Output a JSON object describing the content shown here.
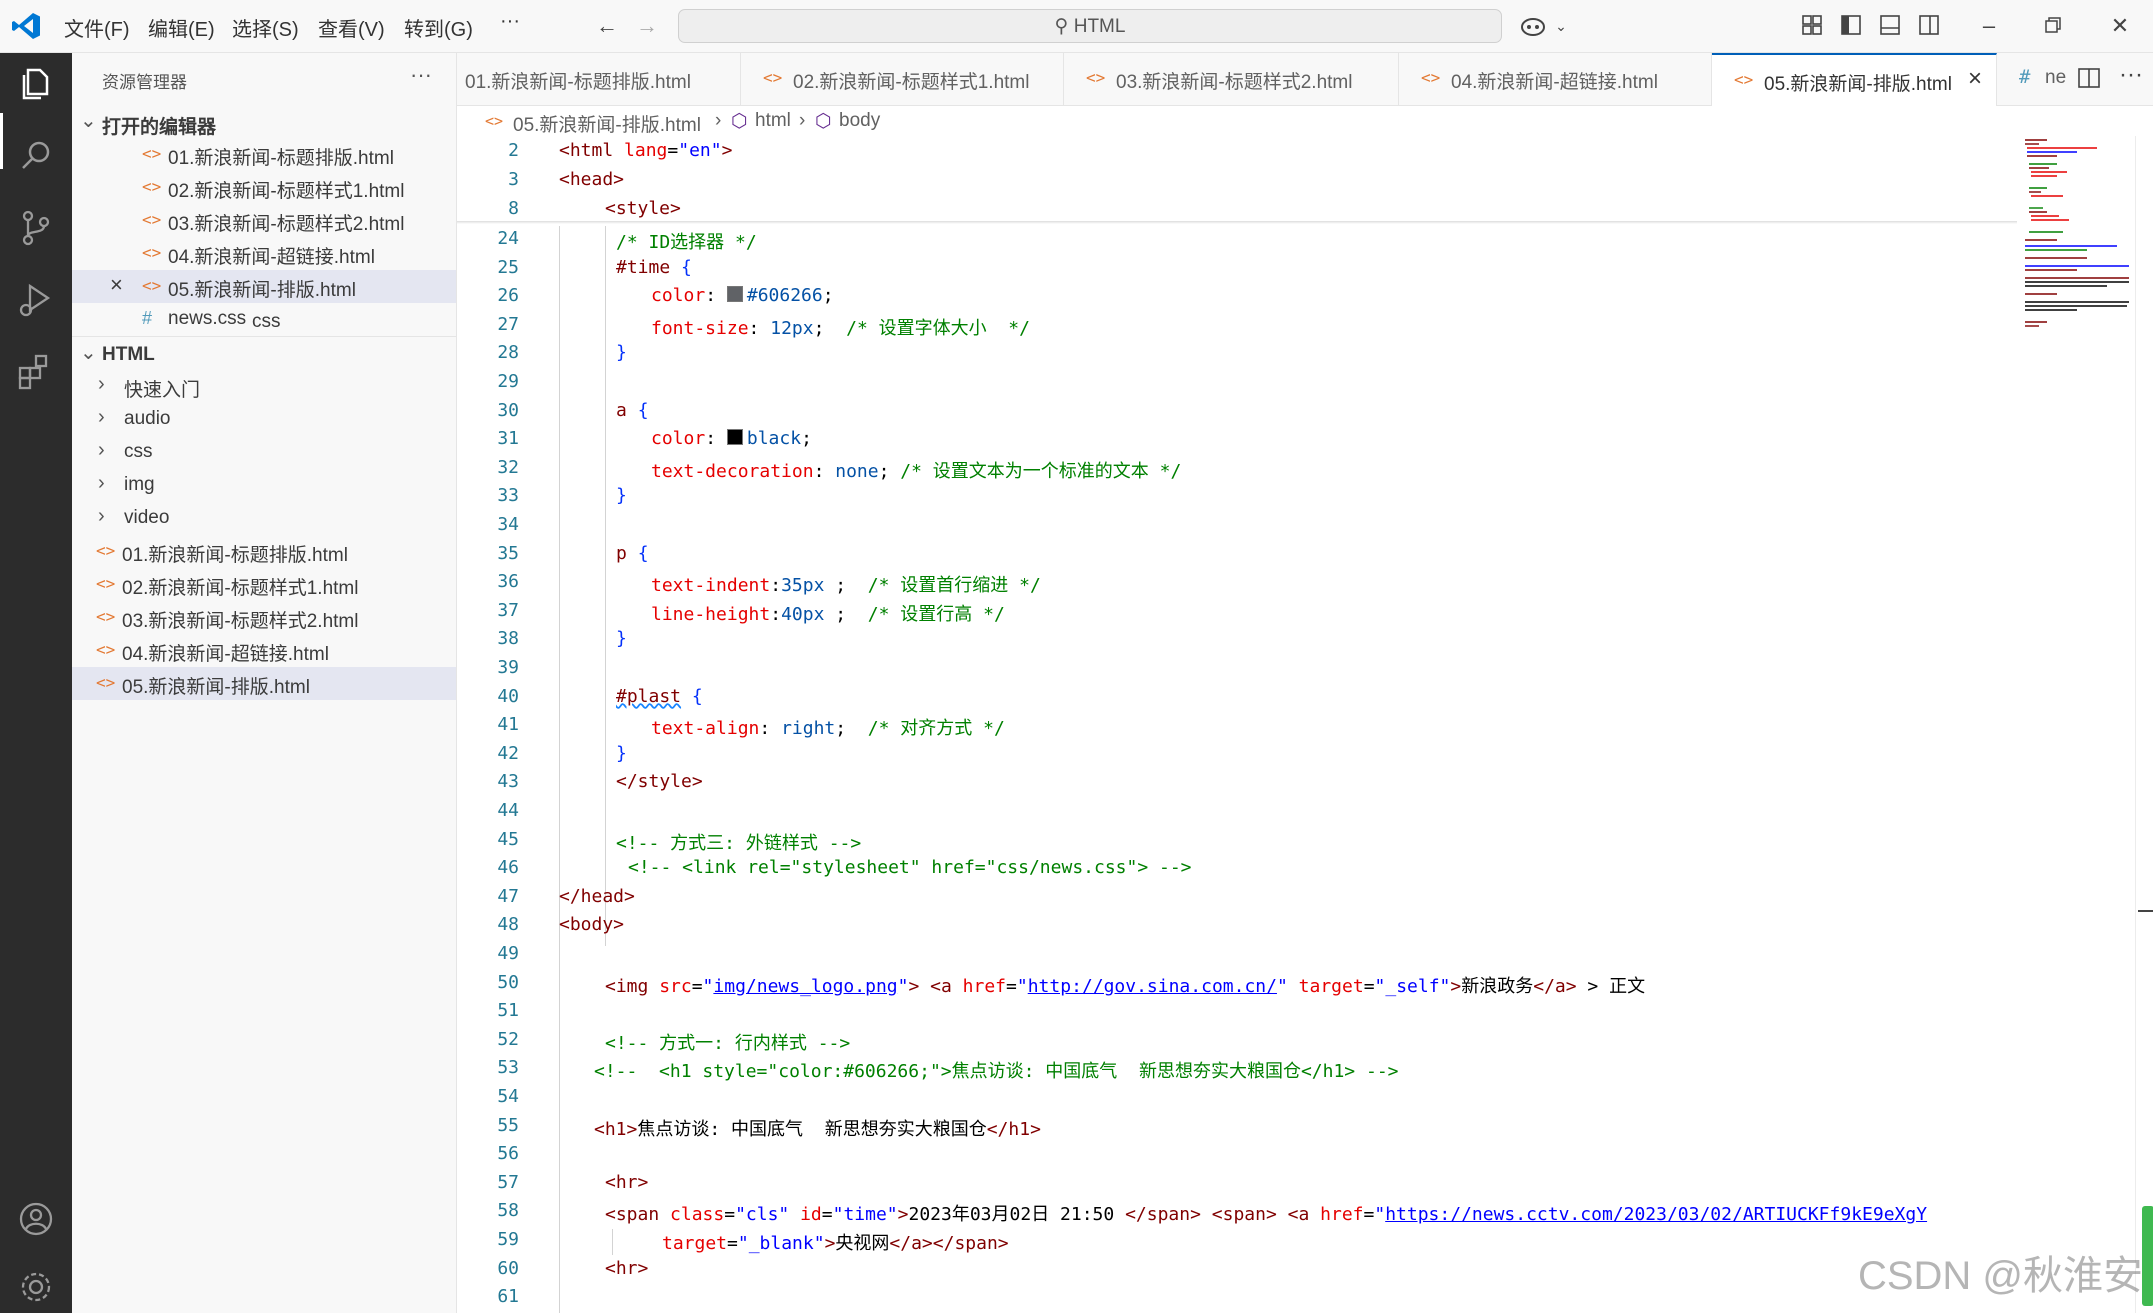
{
  "menu": {
    "file": "文件(F)",
    "edit": "编辑(E)",
    "select": "选择(S)",
    "view": "查看(V)",
    "goto": "转到(G)",
    "more": "···"
  },
  "command_center": {
    "label": "HTML"
  },
  "sidebar": {
    "title": "资源管理器",
    "more": "···",
    "open_editors_header": "打开的编辑器",
    "open_editors": [
      {
        "name": "01.新浪新闻-标题排版.html"
      },
      {
        "name": "02.新浪新闻-标题样式1.html"
      },
      {
        "name": "03.新浪新闻-标题样式2.html"
      },
      {
        "name": "04.新浪新闻-超链接.html"
      },
      {
        "name": "05.新浪新闻-排版.html"
      },
      {
        "name": "news.css",
        "hint": "css"
      }
    ],
    "folder_header": "HTML",
    "folders": [
      "快速入门",
      "audio",
      "css",
      "img",
      "video"
    ],
    "files": [
      "01.新浪新闻-标题排版.html",
      "02.新浪新闻-标题样式1.html",
      "03.新浪新闻-标题样式2.html",
      "04.新浪新闻-超链接.html",
      "05.新浪新闻-排版.html"
    ]
  },
  "tabs": [
    {
      "label": "01.新浪新闻-标题排版.html"
    },
    {
      "label": "02.新浪新闻-标题样式1.html"
    },
    {
      "label": "03.新浪新闻-标题样式2.html"
    },
    {
      "label": "04.新浪新闻-超链接.html"
    },
    {
      "label": "05.新浪新闻-排版.html"
    },
    {
      "label": "ne"
    }
  ],
  "breadcrumb": {
    "file": "05.新浪新闻-排版.html",
    "html": "html",
    "body": "body"
  },
  "sticky_lines": [
    {
      "n": "2",
      "text": "<html lang=\"en\">"
    },
    {
      "n": "3",
      "text": "<head>"
    },
    {
      "n": "8",
      "text": "<style>"
    }
  ],
  "code_lines": [
    {
      "n": "24",
      "text": "/* ID选择器 */"
    },
    {
      "n": "25",
      "text": "#time {"
    },
    {
      "n": "26",
      "text": "color: #606266;"
    },
    {
      "n": "27",
      "text": "font-size: 12px;  /* 设置字体大小  */"
    },
    {
      "n": "28",
      "text": "}"
    },
    {
      "n": "29",
      "text": ""
    },
    {
      "n": "30",
      "text": "a {"
    },
    {
      "n": "31",
      "text": "color: black;"
    },
    {
      "n": "32",
      "text": "text-decoration: none; /* 设置文本为一个标准的文本 */"
    },
    {
      "n": "33",
      "text": "}"
    },
    {
      "n": "34",
      "text": ""
    },
    {
      "n": "35",
      "text": "p {"
    },
    {
      "n": "36",
      "text": "text-indent:35px ;  /* 设置首行缩进 */"
    },
    {
      "n": "37",
      "text": "line-height:40px ;  /* 设置行高 */"
    },
    {
      "n": "38",
      "text": "}"
    },
    {
      "n": "39",
      "text": ""
    },
    {
      "n": "40",
      "text": "#plast {"
    },
    {
      "n": "41",
      "text": "text-align: right;  /* 对齐方式 */"
    },
    {
      "n": "42",
      "text": "}"
    },
    {
      "n": "43",
      "text": "</style>"
    },
    {
      "n": "44",
      "text": ""
    },
    {
      "n": "45",
      "text": "<!-- 方式三: 外链样式 -->"
    },
    {
      "n": "46",
      "text": "<!-- <link rel=\"stylesheet\" href=\"css/news.css\"> -->"
    },
    {
      "n": "47",
      "text": "</head>"
    },
    {
      "n": "48",
      "text": "<body>"
    },
    {
      "n": "49",
      "text": ""
    },
    {
      "n": "50",
      "text": "<img src=\"img/news_logo.png\"> <a href=\"http://gov.sina.com.cn/\" target=\"_self\">新浪政务</a> > 正文"
    },
    {
      "n": "51",
      "text": ""
    },
    {
      "n": "52",
      "text": "<!-- 方式一: 行内样式 -->"
    },
    {
      "n": "53",
      "text": "<!--  <h1 style=\"color:#606266;\">焦点访谈: 中国底气  新思想夯实大粮国仓</h1> -->"
    },
    {
      "n": "54",
      "text": ""
    },
    {
      "n": "55",
      "text": "<h1>焦点访谈: 中国底气  新思想夯实大粮国仓</h1>"
    },
    {
      "n": "56",
      "text": ""
    },
    {
      "n": "57",
      "text": "<hr>"
    },
    {
      "n": "58",
      "text": "<span class=\"cls\" id=\"time\">2023年03月02日 21:50 </span> <span> <a href=\"https://news.cctv.com/2023/03/02/ARTIUCKFf9kE9eXgY"
    },
    {
      "n": "59",
      "text": "target=\"_blank\">央视网</a></span>"
    },
    {
      "n": "60",
      "text": "<hr>"
    },
    {
      "n": "61",
      "text": ""
    }
  ],
  "watermark": "CSDN @秋淮安",
  "colors": {
    "accent": "#005fb8",
    "activity_bar": "#2c2c2c",
    "selection": "#e4e6f1",
    "line_number": "#237893"
  }
}
